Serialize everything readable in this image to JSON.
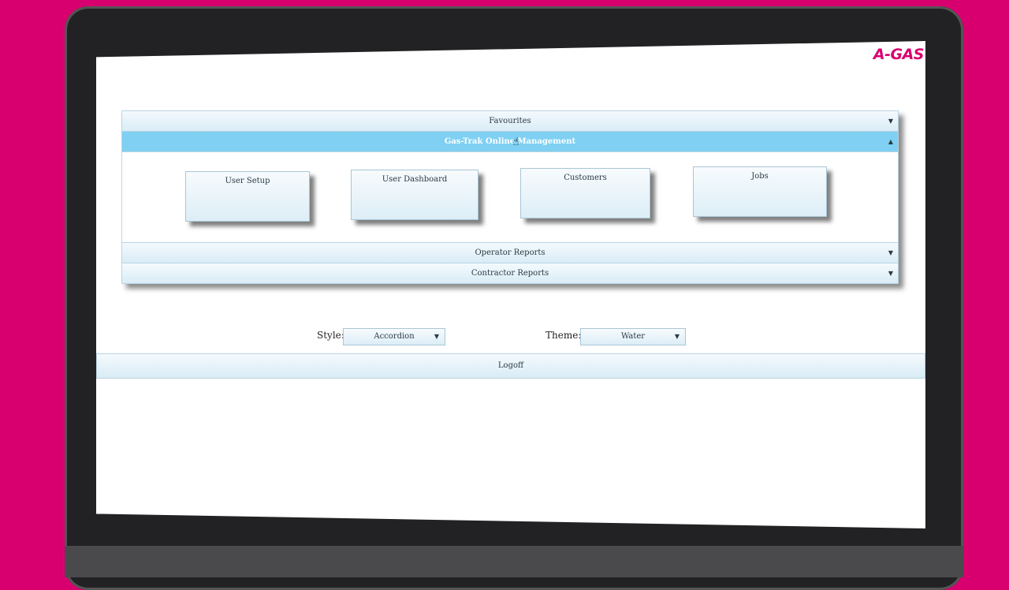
{
  "brand": {
    "logo_text": "A-GAS",
    "color": "#d8006f"
  },
  "accordion": {
    "sections": [
      {
        "label": "Favourites",
        "expanded": false
      },
      {
        "label": "Gas-Trak Online Management",
        "expanded": true
      },
      {
        "label": "Operator Reports",
        "expanded": false
      },
      {
        "label": "Contractor Reports",
        "expanded": false
      }
    ],
    "tiles": [
      "User Setup",
      "User Dashboard",
      "Customers",
      "Jobs"
    ],
    "active_color": "#7fd0f2"
  },
  "controls": {
    "style_label": "Style:",
    "style_value": "Accordion",
    "theme_label": "Theme:",
    "theme_value": "Water"
  },
  "logoff": {
    "label": "Logoff"
  },
  "icons": {
    "collapsed": "▼",
    "expanded": "▲",
    "dropdown": "▼",
    "cursor": "hand-pointer-icon"
  }
}
